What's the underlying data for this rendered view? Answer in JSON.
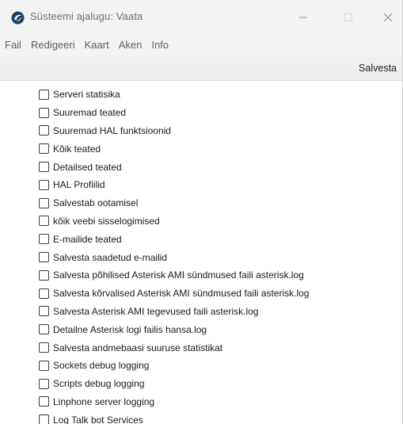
{
  "window": {
    "title": "Süsteemi ajalugu: Vaata",
    "minimize_icon": "minimize-icon",
    "maximize_icon": "maximize-icon",
    "close_icon": "close-icon"
  },
  "menubar": {
    "items": [
      {
        "label": "Fail"
      },
      {
        "label": "Redigeeri"
      },
      {
        "label": "Kaart"
      },
      {
        "label": "Aken"
      },
      {
        "label": "Info"
      }
    ]
  },
  "toolbar": {
    "save_label": "Salvesta"
  },
  "options": [
    {
      "label": "Serveri statisika",
      "checked": false
    },
    {
      "label": "Suuremad teated",
      "checked": false
    },
    {
      "label": "Suuremad HAL funktsioonid",
      "checked": false
    },
    {
      "label": "Kõik teated",
      "checked": false
    },
    {
      "label": "Detailsed teated",
      "checked": false
    },
    {
      "label": "HAL Profiilid",
      "checked": false
    },
    {
      "label": "Salvestab ootamisel",
      "checked": false
    },
    {
      "label": "kõik veebi sisselogimised",
      "checked": false
    },
    {
      "label": "E-mailide teated",
      "checked": false
    },
    {
      "label": "Salvesta saadetud e-mailid",
      "checked": false
    },
    {
      "label": "Salvesta põhilised Asterisk AMI sündmused faili asterisk.log",
      "checked": false
    },
    {
      "label": "Salvesta kõrvalised Asterisk AMI sündmused faili asterisk.log",
      "checked": false
    },
    {
      "label": "Salvesta Asterisk AMI tegevused faili asterisk.log",
      "checked": false
    },
    {
      "label": "Detailne Asterisk logi failis hansa.log",
      "checked": false
    },
    {
      "label": "Salvesta andmebaasi suuruse statistikat",
      "checked": false
    },
    {
      "label": "Sockets debug logging",
      "checked": false
    },
    {
      "label": "Scripts debug logging",
      "checked": false
    },
    {
      "label": "Linphone server logging",
      "checked": false
    },
    {
      "label": "Log Talk bot Services",
      "checked": false
    }
  ]
}
